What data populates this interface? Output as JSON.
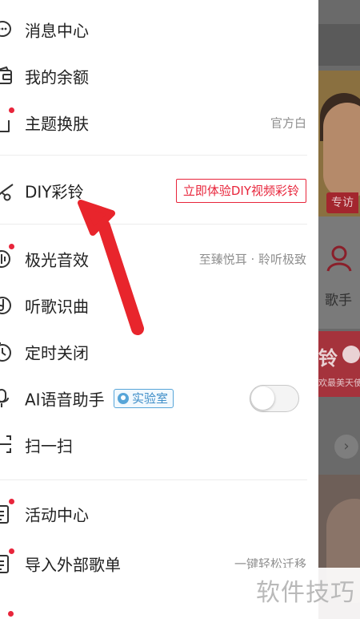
{
  "menu": {
    "items": [
      {
        "id": "messages",
        "icon": "chat-bubble-icon",
        "label": "消息中心",
        "badge_dot": false,
        "value": ""
      },
      {
        "id": "balance",
        "icon": "wallet-icon",
        "label": "我的余额",
        "badge_dot": false,
        "value": ""
      },
      {
        "id": "theme",
        "icon": "tshirt-icon",
        "label": "主题换肤",
        "badge_dot": true,
        "value": "官方白"
      },
      {
        "id": "diy-ringtone",
        "icon": "scissors-icon",
        "label": "DIY彩铃",
        "badge_dot": false,
        "button": "立即体验DIY视频彩铃"
      },
      {
        "id": "aurora-sound",
        "icon": "sound-effect-icon",
        "label": "极光音效",
        "badge_dot": true,
        "value": "至臻悦耳 · 聆听极致"
      },
      {
        "id": "song-recognition",
        "icon": "music-recognize-icon",
        "label": "听歌识曲",
        "badge_dot": false,
        "value": ""
      },
      {
        "id": "sleep-timer",
        "icon": "timer-icon",
        "label": "定时关闭",
        "badge_dot": false,
        "value": ""
      },
      {
        "id": "ai-voice",
        "icon": "microphone-icon",
        "label": "AI语音助手",
        "badge_dot": false,
        "badge": "实验室",
        "toggle_on": false
      },
      {
        "id": "scan",
        "icon": "scan-icon",
        "label": "扫一扫",
        "badge_dot": false,
        "value": ""
      },
      {
        "id": "events",
        "icon": "event-list-icon",
        "label": "活动中心",
        "badge_dot": true,
        "value": ""
      },
      {
        "id": "import-playlist",
        "icon": "import-list-icon",
        "label": "导入外部歌单",
        "badge_dot": true,
        "value": "一键轻松迁移"
      }
    ]
  },
  "background": {
    "tag": "专访",
    "singer_label": "歌手",
    "promo_big": "铃",
    "promo_sub": "欢最美天使"
  },
  "watermark": "软件技巧",
  "colors": {
    "accent_red": "#e8253b",
    "badge_blue": "#57a5d8",
    "annotation_arrow": "#e8252c"
  }
}
